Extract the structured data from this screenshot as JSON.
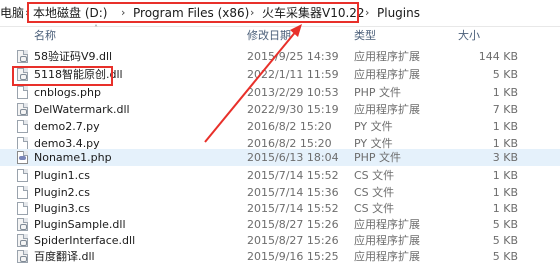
{
  "address_bar": {
    "crumbs": [
      "电脑",
      "本地磁盘 (D:)",
      "Program Files (x86)",
      "火车采集器V10.22",
      "Plugins"
    ]
  },
  "columns": {
    "name": "名称",
    "date": "修改日期",
    "type": "类型",
    "size": "大小"
  },
  "files": [
    {
      "name": "58验证码V9.dll",
      "date": "2015/9/25 14:39",
      "type": "应用程序扩展",
      "size": "144 KB",
      "icon": "dll-file-icon"
    },
    {
      "name": "5118智能原创.dll",
      "date": "2022/1/11 11:59",
      "type": "应用程序扩展",
      "size": "5 KB",
      "icon": "dll-file-icon"
    },
    {
      "name": "cnblogs.php",
      "date": "2013/2/29 10:53",
      "type": "PHP 文件",
      "size": "1 KB",
      "icon": "generic-file-icon"
    },
    {
      "name": "DelWatermark.dll",
      "date": "2022/9/30 15:19",
      "type": "应用程序扩展",
      "size": "7 KB",
      "icon": "dll-file-icon"
    },
    {
      "name": "demo2.7.py",
      "date": "2016/8/2 15:20",
      "type": "PY 文件",
      "size": "1 KB",
      "icon": "generic-file-icon"
    },
    {
      "name": "demo3.4.py",
      "date": "2016/8/2 15:20",
      "type": "PY 文件",
      "size": "1 KB",
      "icon": "generic-file-icon"
    },
    {
      "name": "Noname1.php",
      "date": "2015/6/13 18:04",
      "type": "PHP 文件",
      "size": "3 KB",
      "icon": "php-file-icon"
    },
    {
      "name": "Plugin1.cs",
      "date": "2015/7/14 15:52",
      "type": "CS 文件",
      "size": "1 KB",
      "icon": "generic-file-icon"
    },
    {
      "name": "Plugin2.cs",
      "date": "2015/7/14 15:36",
      "type": "CS 文件",
      "size": "1 KB",
      "icon": "generic-file-icon"
    },
    {
      "name": "Plugin3.cs",
      "date": "2015/7/14 15:52",
      "type": "CS 文件",
      "size": "1 KB",
      "icon": "generic-file-icon"
    },
    {
      "name": "PluginSample.dll",
      "date": "2015/8/27 15:26",
      "type": "应用程序扩展",
      "size": "5 KB",
      "icon": "dll-file-icon"
    },
    {
      "name": "SpiderInterface.dll",
      "date": "2015/8/27 15:26",
      "type": "应用程序扩展",
      "size": "5 KB",
      "icon": "dll-file-icon"
    },
    {
      "name": "百度翻译.dll",
      "date": "2015/9/16 15:25",
      "type": "应用程序扩展",
      "size": "5 KB",
      "icon": "dll-file-icon"
    }
  ],
  "selected_row": "Noname1.php",
  "colors": {
    "annotation": "#e8302a",
    "selection": "#e5f1fb",
    "header_text": "#4c607a"
  }
}
